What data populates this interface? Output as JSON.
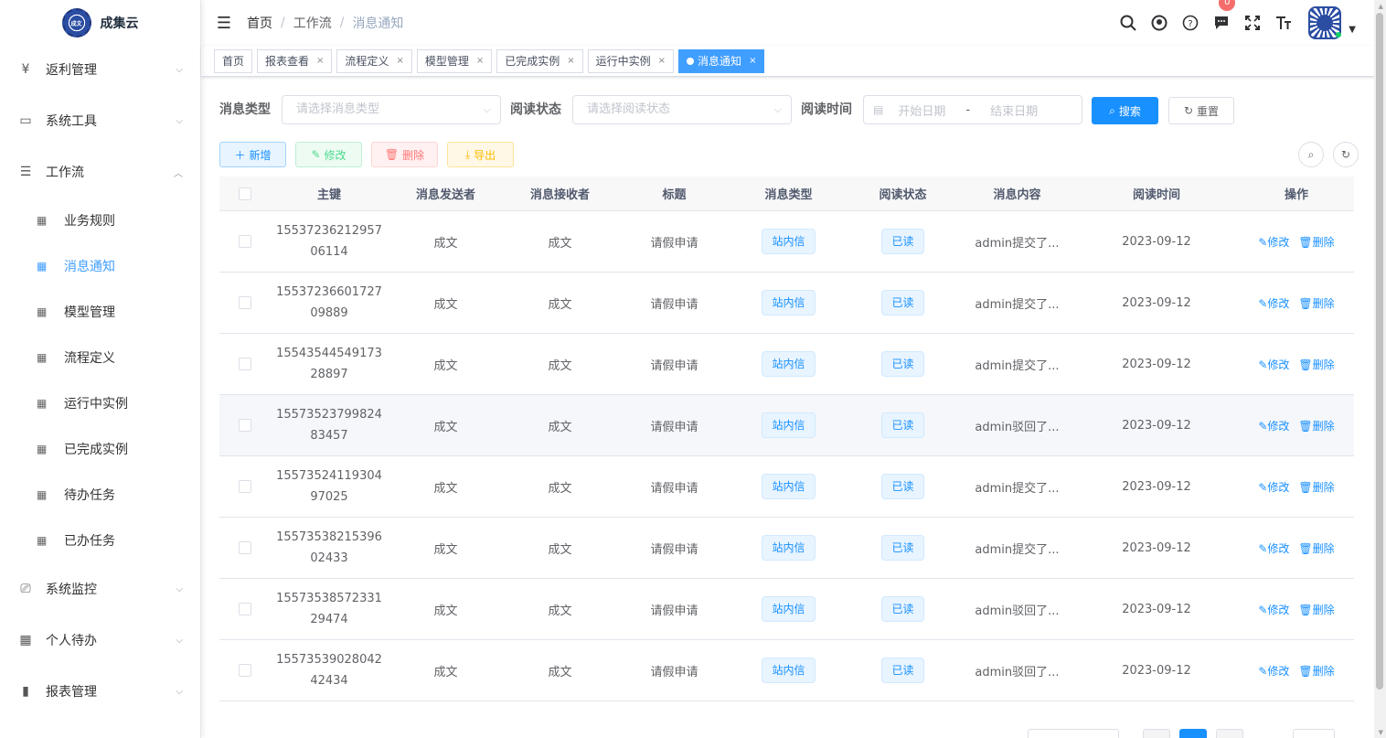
{
  "app": {
    "title": "成集云"
  },
  "sidebar": {
    "menus": [
      {
        "label": "返利管理",
        "icon": "yen-icon"
      },
      {
        "label": "系统工具",
        "icon": "toolbox-icon"
      },
      {
        "label": "工作流",
        "icon": "tree-icon",
        "expanded": true
      },
      {
        "label": "系统监控",
        "icon": "monitor-icon"
      },
      {
        "label": "个人待办",
        "icon": "grid-icon"
      },
      {
        "label": "报表管理",
        "icon": "chart-icon"
      },
      {
        "label": "..."
      }
    ],
    "submenu": [
      {
        "label": "业务规则"
      },
      {
        "label": "消息通知",
        "active": true
      },
      {
        "label": "模型管理"
      },
      {
        "label": "流程定义"
      },
      {
        "label": "运行中实例"
      },
      {
        "label": "已完成实例"
      },
      {
        "label": "待办任务"
      },
      {
        "label": "已办任务"
      }
    ]
  },
  "header": {
    "breadcrumb": [
      "首页",
      "工作流",
      "消息通知"
    ],
    "message_badge": "0"
  },
  "tabs": [
    {
      "label": "首页",
      "closable": false
    },
    {
      "label": "报表查看",
      "closable": true
    },
    {
      "label": "流程定义",
      "closable": true
    },
    {
      "label": "模型管理",
      "closable": true
    },
    {
      "label": "已完成实例",
      "closable": true
    },
    {
      "label": "运行中实例",
      "closable": true
    },
    {
      "label": "消息通知",
      "closable": true,
      "active": true
    }
  ],
  "search": {
    "type_label": "消息类型",
    "type_placeholder": "请选择消息类型",
    "status_label": "阅读状态",
    "status_placeholder": "请选择阅读状态",
    "time_label": "阅读时间",
    "start_placeholder": "开始日期",
    "range_sep": "-",
    "end_placeholder": "结束日期",
    "search_btn": "搜索",
    "reset_btn": "重置"
  },
  "toolbar": {
    "add": "新增",
    "edit": "修改",
    "delete": "删除",
    "export": "导出"
  },
  "table": {
    "columns": [
      "主键",
      "消息发送者",
      "消息接收者",
      "标题",
      "消息类型",
      "阅读状态",
      "消息内容",
      "阅读时间",
      "操作"
    ],
    "edit_label": "修改",
    "delete_label": "删除",
    "rows": [
      {
        "id_1": "15537236212957",
        "id_2": "06114",
        "sender": "成文",
        "receiver": "成文",
        "title": "请假申请",
        "type": "站内信",
        "status": "已读",
        "content": "admin提交了...",
        "time": "2023-09-12"
      },
      {
        "id_1": "15537236601727",
        "id_2": "09889",
        "sender": "成文",
        "receiver": "成文",
        "title": "请假申请",
        "type": "站内信",
        "status": "已读",
        "content": "admin提交了...",
        "time": "2023-09-12"
      },
      {
        "id_1": "15543544549173",
        "id_2": "28897",
        "sender": "成文",
        "receiver": "成文",
        "title": "请假申请",
        "type": "站内信",
        "status": "已读",
        "content": "admin提交了...",
        "time": "2023-09-12"
      },
      {
        "id_1": "15573523799824",
        "id_2": "83457",
        "sender": "成文",
        "receiver": "成文",
        "title": "请假申请",
        "type": "站内信",
        "status": "已读",
        "content": "admin驳回了...",
        "time": "2023-09-12"
      },
      {
        "id_1": "15573524119304",
        "id_2": "97025",
        "sender": "成文",
        "receiver": "成文",
        "title": "请假申请",
        "type": "站内信",
        "status": "已读",
        "content": "admin提交了...",
        "time": "2023-09-12"
      },
      {
        "id_1": "15573538215396",
        "id_2": "02433",
        "sender": "成文",
        "receiver": "成文",
        "title": "请假申请",
        "type": "站内信",
        "status": "已读",
        "content": "admin提交了...",
        "time": "2023-09-12"
      },
      {
        "id_1": "15573538572331",
        "id_2": "29474",
        "sender": "成文",
        "receiver": "成文",
        "title": "请假申请",
        "type": "站内信",
        "status": "已读",
        "content": "admin驳回了...",
        "time": "2023-09-12"
      },
      {
        "id_1": "15573539028042",
        "id_2": "42434",
        "sender": "成文",
        "receiver": "成文",
        "title": "请假申请",
        "type": "站内信",
        "status": "已读",
        "content": "admin驳回了...",
        "time": "2023-09-12"
      }
    ]
  },
  "colors": {
    "primary": "#1890ff",
    "active_tab": "#409eff",
    "badge": "#f56c6c"
  }
}
